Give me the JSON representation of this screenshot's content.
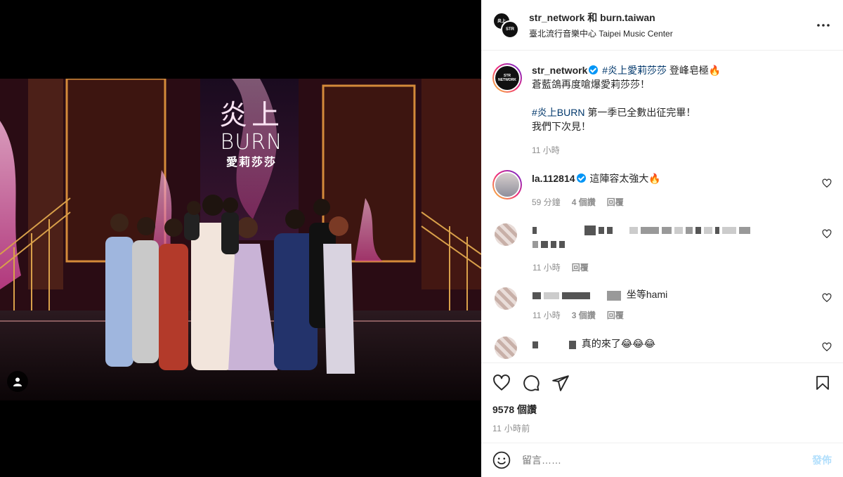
{
  "header": {
    "accounts": "str_network 和 burn.taiwan",
    "location": "臺北流行音樂中心 Taipei Music Center",
    "avatar_text_1": "炎上",
    "avatar_text_2": "STR"
  },
  "caption": {
    "username": "str_network",
    "hashtag_1": "#炎上愛莉莎莎",
    "text_1": " 登峰皂極🔥",
    "line_2": "蒼藍鴿再度嗆爆愛莉莎莎！",
    "hashtag_2": "#炎上BURN",
    "text_2": " 第一季已全數出征完畢！",
    "line_4": "我們下次見！",
    "time": "11 小時",
    "avatar_text": "STR NETWORK"
  },
  "comments": [
    {
      "username": "la.112814",
      "text": "這陣容太強大🔥",
      "time": "59 分鐘",
      "likes": "4 個讚",
      "reply": "回覆"
    },
    {
      "time": "11 小時",
      "reply": "回覆"
    },
    {
      "text": "坐等hami",
      "time": "11 小時",
      "likes": "3 個讚",
      "reply": "回覆"
    },
    {
      "text": "真的來了😂😂😂"
    }
  ],
  "actions": {
    "likes": "9578 個讚",
    "ago": "11 小時前"
  },
  "composer": {
    "placeholder": "留言……",
    "post_label": "發佈"
  },
  "photo_logo": {
    "title": "炎上",
    "brand": "BURN",
    "subtitle": "愛莉莎莎"
  },
  "colors": {
    "link": "#00376b",
    "verified": "#0095f6",
    "muted": "#8e8e8e",
    "post_disabled": "#b2dffc"
  }
}
